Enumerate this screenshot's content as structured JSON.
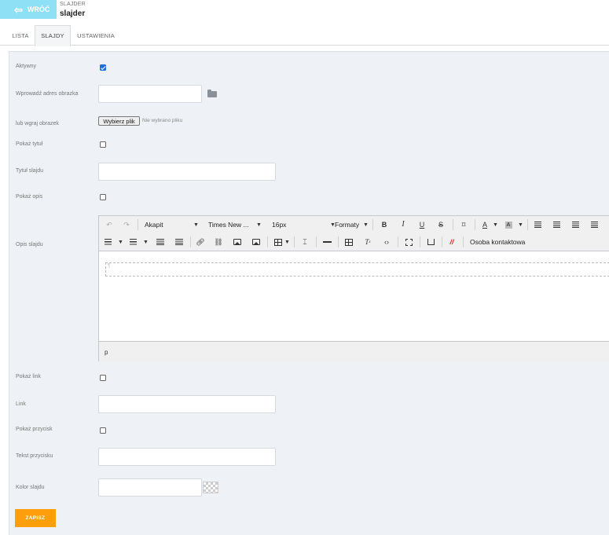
{
  "header": {
    "back_label": "WRÓĆ",
    "section": "SLAJDER",
    "title": "slajder"
  },
  "tabs": [
    {
      "label": "LISTA",
      "active": false
    },
    {
      "label": "SLAJDY",
      "active": true
    },
    {
      "label": "USTAWIENIA",
      "active": false
    }
  ],
  "form": {
    "active_label": "Aktywny",
    "active_checked": true,
    "image_url_label": "Wprowadź adres obrazka",
    "image_url_value": "",
    "upload_label": "lub wgraj obrazek",
    "upload_button": "Wybierz plik",
    "upload_status": "Nie wybrano pliku",
    "show_title_label": "Pokaż tytuł",
    "show_title_checked": false,
    "slide_title_label": "Tytuł slajdu",
    "slide_title_value": "",
    "show_desc_label": "Pokaż opis",
    "show_desc_checked": false,
    "slide_desc_label": "Opis slajdu",
    "show_link_label": "Pokaż link",
    "show_link_checked": false,
    "link_label": "Link",
    "link_value": "",
    "show_button_label": "Pokaż przycisk",
    "show_button_checked": false,
    "button_text_label": "Tekst przycisku",
    "button_text_value": "",
    "slide_color_label": "Kolor slajdu",
    "slide_color_value": "",
    "save_label": "ZAPISZ"
  },
  "editor": {
    "paragraph_format": "Akapit",
    "font_family": "Times New ...",
    "font_size": "16px",
    "formats_label": "Formaty",
    "contact_label": "Osoba kontaktowa",
    "status_path": "p",
    "pilcrow": "¶",
    "accent_colors": {
      "save": "#ff9e0d",
      "back": "#8ee0f5",
      "checkbox": "#1e6fd9"
    }
  }
}
